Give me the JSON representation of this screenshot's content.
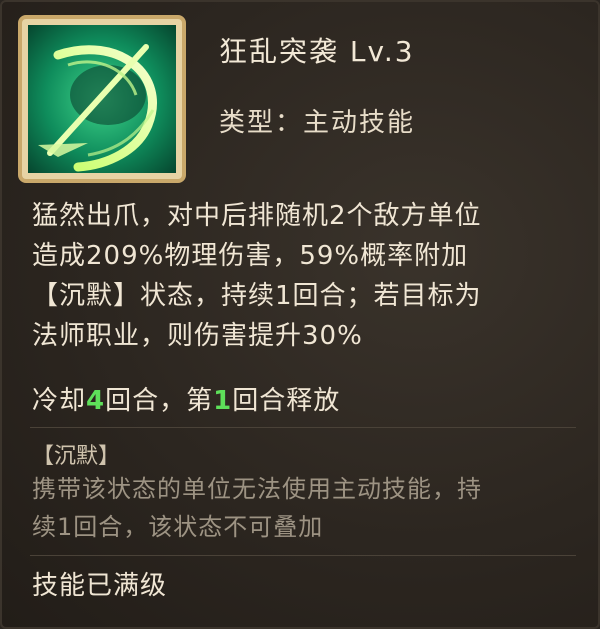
{
  "skill": {
    "name": "狂乱突袭 Lv.3",
    "type": "类型：主动技能",
    "icon": "green-claw-slash-icon"
  },
  "description": {
    "lines": [
      "猛然出爪，对中后排随机2个敌方单位",
      "造成209%物理伤害，59%概率附加",
      "【沉默】状态，持续1回合；若目标为",
      "法师职业，则伤害提升30%"
    ]
  },
  "cooldown": {
    "prefix": "冷却",
    "turns": "4",
    "middle": "回合，第",
    "release_turn": "1",
    "suffix": "回合释放"
  },
  "status_effect": {
    "title": "【沉默】",
    "lines": [
      "携带该状态的单位无法使用主动技能，持",
      "续1回合，该状态不可叠加"
    ]
  },
  "level_status": "技能已满级",
  "colors": {
    "highlight": "#5ee05a",
    "icon_border": "#c9a86a",
    "background": "#2c2620"
  }
}
